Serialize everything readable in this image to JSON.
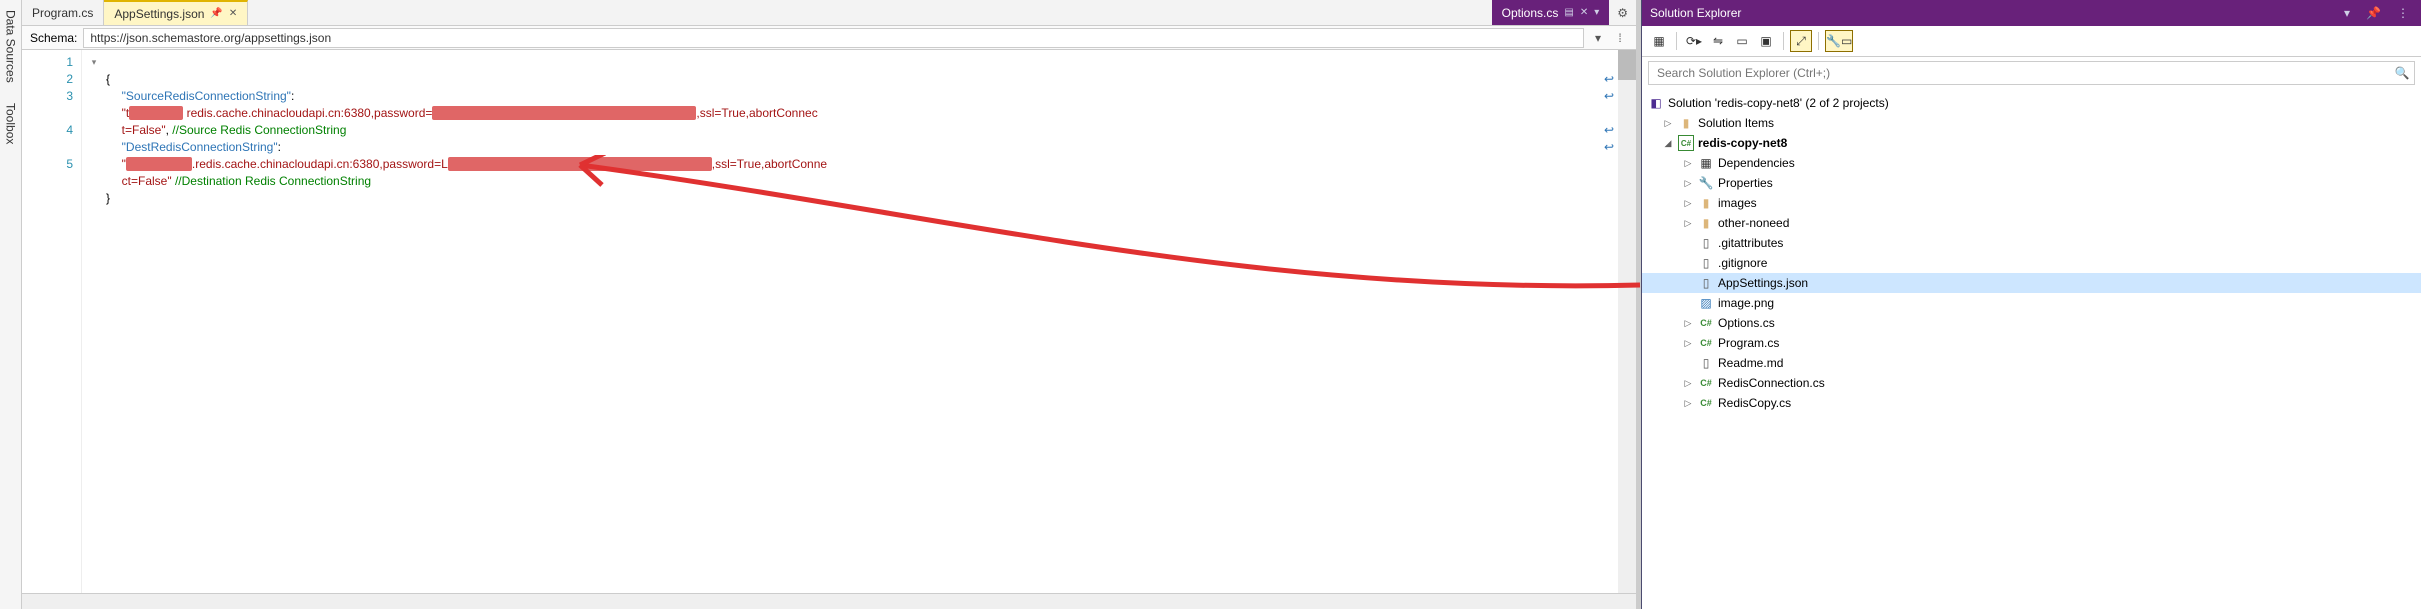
{
  "sidebar": {
    "tabs": [
      "Data Sources",
      "Toolbox"
    ]
  },
  "tabs": {
    "items": [
      {
        "label": "Program.cs",
        "active": false,
        "pinned": false
      },
      {
        "label": "AppSettings.json",
        "active": true,
        "pinned": true
      },
      {
        "label": "Options.cs",
        "active": false,
        "preview": true
      }
    ]
  },
  "schema": {
    "label": "Schema:",
    "value": "https://json.schemastore.org/appsettings.json"
  },
  "code": {
    "lines": [
      "1",
      "2",
      "3",
      "4",
      "5"
    ],
    "l1": "{",
    "l2_prop": "\"SourceRedisConnectionString\"",
    "l2_sep": ":",
    "l2_val_a": "\"t",
    "l2_val_b": " redis.cache.chinacloudapi.cn:6380,password=",
    "l2_val_c": ",ssl=True,abortConnec",
    "l2_wrap": "t=False\"",
    "l2_comma": ", ",
    "l2_com": "//Source Redis ConnectionString",
    "l3_prop": "\"DestRedisConnectionString\"",
    "l3_sep": ":",
    "l3_val_a": "\"",
    "l3_val_b": ".redis.cache.chinacloudapi.cn:6380,password=L",
    "l3_val_c": ",ssl=True,abortConne",
    "l3_wrap": "ct=False\"",
    "l3_space": " ",
    "l3_com": "//Destination Redis ConnectionString",
    "l4": "}"
  },
  "solution_explorer": {
    "title": "Solution Explorer",
    "search_placeholder": "Search Solution Explorer (Ctrl+;)",
    "root": "Solution 'redis-copy-net8' (2 of 2 projects)",
    "folders": {
      "solution_items": "Solution Items",
      "project": "redis-copy-net8",
      "deps": "Dependencies",
      "props": "Properties",
      "images": "images",
      "other": "other-noneed"
    },
    "files": {
      "gitattributes": ".gitattributes",
      "gitignore": ".gitignore",
      "appsettings": "AppSettings.json",
      "imagepng": "image.png",
      "options": "Options.cs",
      "program": "Program.cs",
      "readme": "Readme.md",
      "redisconn": "RedisConnection.cs",
      "rediscopy": "RedisCopy.cs"
    }
  }
}
